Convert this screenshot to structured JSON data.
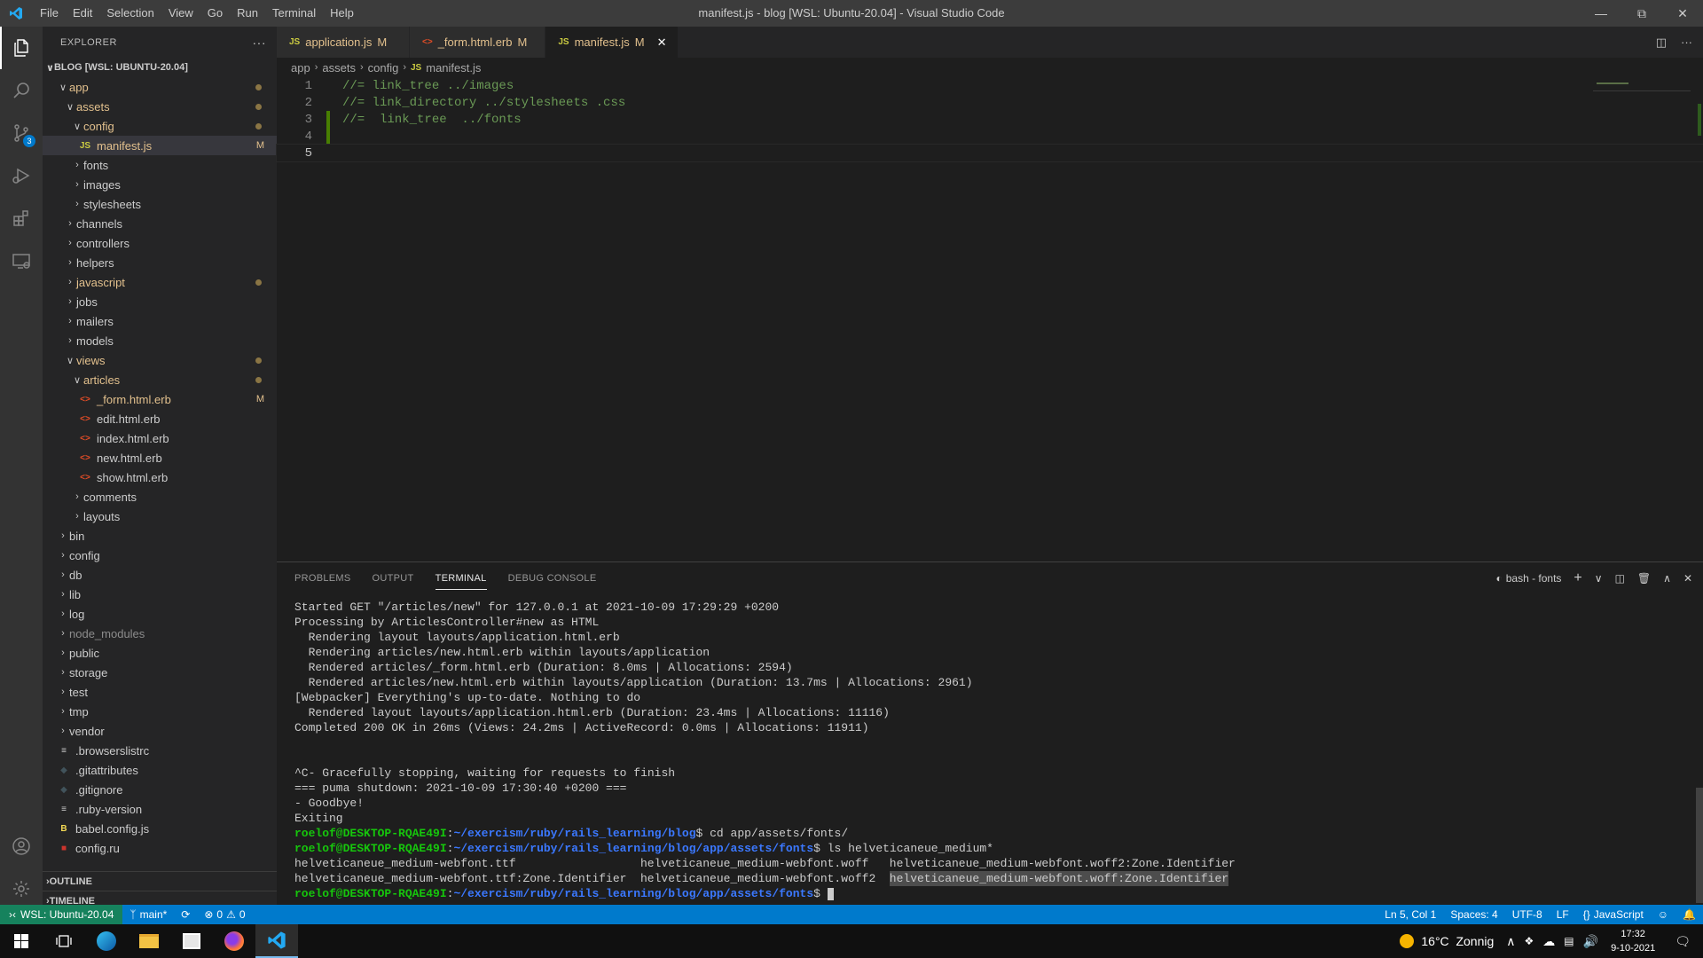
{
  "window": {
    "title": "manifest.js - blog [WSL: Ubuntu-20.04] - Visual Studio Code",
    "menu": [
      "File",
      "Edit",
      "Selection",
      "View",
      "Go",
      "Run",
      "Terminal",
      "Help"
    ]
  },
  "activity": {
    "scm_badge": "3"
  },
  "sidebar": {
    "header": "EXPLORER",
    "root": "BLOG [WSL: UBUNTU-20.04]",
    "outline": "OUTLINE",
    "timeline": "TIMELINE",
    "tree": [
      {
        "label": "app",
        "type": "folder",
        "open": true,
        "depth": 1,
        "status": "dot",
        "color": "mod"
      },
      {
        "label": "assets",
        "type": "folder",
        "open": true,
        "depth": 2,
        "status": "dot",
        "color": "mod"
      },
      {
        "label": "config",
        "type": "folder",
        "open": true,
        "depth": 3,
        "status": "dot",
        "color": "mod"
      },
      {
        "label": "manifest.js",
        "type": "js",
        "depth": 4,
        "status": "M",
        "color": "mod",
        "selected": true
      },
      {
        "label": "fonts",
        "type": "folder",
        "open": false,
        "depth": 3
      },
      {
        "label": "images",
        "type": "folder",
        "open": false,
        "depth": 3
      },
      {
        "label": "stylesheets",
        "type": "folder",
        "open": false,
        "depth": 3
      },
      {
        "label": "channels",
        "type": "folder",
        "open": false,
        "depth": 2
      },
      {
        "label": "controllers",
        "type": "folder",
        "open": false,
        "depth": 2
      },
      {
        "label": "helpers",
        "type": "folder",
        "open": false,
        "depth": 2
      },
      {
        "label": "javascript",
        "type": "folder",
        "open": false,
        "depth": 2,
        "status": "dot",
        "color": "mod"
      },
      {
        "label": "jobs",
        "type": "folder",
        "open": false,
        "depth": 2
      },
      {
        "label": "mailers",
        "type": "folder",
        "open": false,
        "depth": 2
      },
      {
        "label": "models",
        "type": "folder",
        "open": false,
        "depth": 2
      },
      {
        "label": "views",
        "type": "folder",
        "open": true,
        "depth": 2,
        "status": "dot",
        "color": "mod"
      },
      {
        "label": "articles",
        "type": "folder",
        "open": true,
        "depth": 3,
        "status": "dot",
        "color": "mod"
      },
      {
        "label": "_form.html.erb",
        "type": "erb",
        "depth": 4,
        "status": "M",
        "color": "mod"
      },
      {
        "label": "edit.html.erb",
        "type": "erb",
        "depth": 4
      },
      {
        "label": "index.html.erb",
        "type": "erb",
        "depth": 4
      },
      {
        "label": "new.html.erb",
        "type": "erb",
        "depth": 4
      },
      {
        "label": "show.html.erb",
        "type": "erb",
        "depth": 4
      },
      {
        "label": "comments",
        "type": "folder",
        "open": false,
        "depth": 3
      },
      {
        "label": "layouts",
        "type": "folder",
        "open": false,
        "depth": 3
      },
      {
        "label": "bin",
        "type": "folder",
        "open": false,
        "depth": 1
      },
      {
        "label": "config",
        "type": "folder",
        "open": false,
        "depth": 1
      },
      {
        "label": "db",
        "type": "folder",
        "open": false,
        "depth": 1
      },
      {
        "label": "lib",
        "type": "folder",
        "open": false,
        "depth": 1
      },
      {
        "label": "log",
        "type": "folder",
        "open": false,
        "depth": 1
      },
      {
        "label": "node_modules",
        "type": "folder",
        "open": false,
        "depth": 1,
        "color": "dim"
      },
      {
        "label": "public",
        "type": "folder",
        "open": false,
        "depth": 1
      },
      {
        "label": "storage",
        "type": "folder",
        "open": false,
        "depth": 1
      },
      {
        "label": "test",
        "type": "folder",
        "open": false,
        "depth": 1
      },
      {
        "label": "tmp",
        "type": "folder",
        "open": false,
        "depth": 1
      },
      {
        "label": "vendor",
        "type": "folder",
        "open": false,
        "depth": 1
      },
      {
        "label": ".browserslistrc",
        "type": "text",
        "depth": 1
      },
      {
        "label": ".gitattributes",
        "type": "git",
        "depth": 1
      },
      {
        "label": ".gitignore",
        "type": "git",
        "depth": 1
      },
      {
        "label": ".ruby-version",
        "type": "text",
        "depth": 1
      },
      {
        "label": "babel.config.js",
        "type": "babel",
        "depth": 1
      },
      {
        "label": "config.ru",
        "type": "ruby",
        "depth": 1
      }
    ]
  },
  "tabs": [
    {
      "label": "application.js",
      "status": "M",
      "icon": "JS",
      "active": false
    },
    {
      "label": "_form.html.erb",
      "status": "M",
      "icon": "<>",
      "active": false
    },
    {
      "label": "manifest.js",
      "status": "M",
      "icon": "JS",
      "active": true
    }
  ],
  "breadcrumb": [
    "app",
    "assets",
    "config",
    "manifest.js"
  ],
  "editor": {
    "lines": [
      {
        "n": "1",
        "text": "//= link_tree ../images",
        "gutter": "none"
      },
      {
        "n": "2",
        "text": "//= link_directory ../stylesheets .css",
        "gutter": "none"
      },
      {
        "n": "3",
        "text": "//=  link_tree  ../fonts",
        "gutter": "added"
      },
      {
        "n": "4",
        "text": "",
        "gutter": "added"
      },
      {
        "n": "5",
        "text": "",
        "gutter": "none",
        "current": true
      }
    ]
  },
  "panel": {
    "tabs": [
      "PROBLEMS",
      "OUTPUT",
      "TERMINAL",
      "DEBUG CONSOLE"
    ],
    "active_tab": "TERMINAL",
    "terminal_name": "bash - fonts",
    "lines": [
      "Started GET \"/articles/new\" for 127.0.0.1 at 2021-10-09 17:29:29 +0200",
      "Processing by ArticlesController#new as HTML",
      "  Rendering layout layouts/application.html.erb",
      "  Rendering articles/new.html.erb within layouts/application",
      "  Rendered articles/_form.html.erb (Duration: 8.0ms | Allocations: 2594)",
      "  Rendered articles/new.html.erb within layouts/application (Duration: 13.7ms | Allocations: 2961)",
      "[Webpacker] Everything's up-to-date. Nothing to do",
      "  Rendered layout layouts/application.html.erb (Duration: 23.4ms | Allocations: 11116)",
      "Completed 200 OK in 26ms (Views: 24.2ms | ActiveRecord: 0.0ms | Allocations: 11911)",
      "",
      "",
      "^C- Gracefully stopping, waiting for requests to finish",
      "=== puma shutdown: 2021-10-09 17:30:40 +0200 ===",
      "- Goodbye!",
      "Exiting"
    ],
    "prompt_user": "roelof@DESKTOP-RQAE49I",
    "prompts": [
      {
        "path": "~/exercism/ruby/rails_learning/blog",
        "cmd": " cd app/assets/fonts/"
      },
      {
        "path": "~/exercism/ruby/rails_learning/blog/app/assets/fonts",
        "cmd": " ls helveticaneue_medium*"
      }
    ],
    "ls_rows": [
      [
        "helveticaneue_medium-webfont.ttf",
        "helveticaneue_medium-webfont.woff",
        "helveticaneue_medium-webfont.woff2:Zone.Identifier"
      ],
      [
        "helveticaneue_medium-webfont.ttf:Zone.Identifier",
        "helveticaneue_medium-webfont.woff2",
        "helveticaneue_medium-webfont.woff:Zone.Identifier"
      ]
    ],
    "final_prompt_path": "~/exercism/ruby/rails_learning/blog/app/assets/fonts"
  },
  "status": {
    "remote": "WSL: Ubuntu-20.04",
    "branch": "main*",
    "errors": "0",
    "warnings": "0",
    "position": "Ln 5, Col 1",
    "spaces": "Spaces: 4",
    "encoding": "UTF-8",
    "eol": "LF",
    "language": "JavaScript"
  },
  "taskbar": {
    "weather": "16°C  Zonnig",
    "time": "17:32",
    "date": "9-10-2021"
  }
}
